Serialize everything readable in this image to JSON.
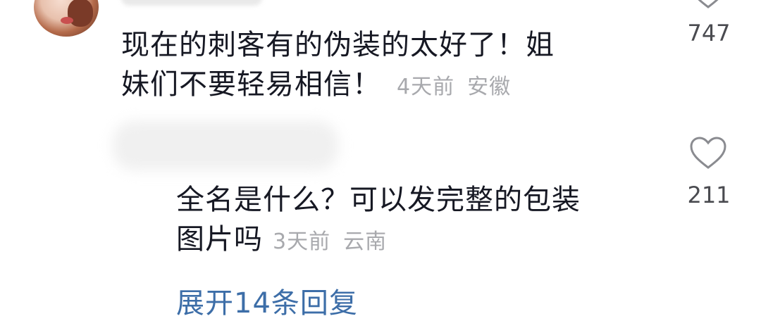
{
  "comments": [
    {
      "text_line1": "现在的刺客有的伪装的太好了！姐",
      "text_line2": "妹们不要轻易相信！",
      "time": "4天前",
      "region": "安徽",
      "likes": "747"
    },
    {
      "text_line1": "全名是什么？可以发完整的包装",
      "text_line2": "图片吗",
      "time": "3天前",
      "region": "云南",
      "likes": "211"
    }
  ],
  "expand_replies": "展开14条回复",
  "icons": {
    "avatar": "avatar-image",
    "like": "heart-outline-icon"
  },
  "colors": {
    "text": "#161823",
    "meta": "#a8a9ad",
    "link": "#3d6ea8",
    "heart_stroke": "#8a8b90"
  }
}
